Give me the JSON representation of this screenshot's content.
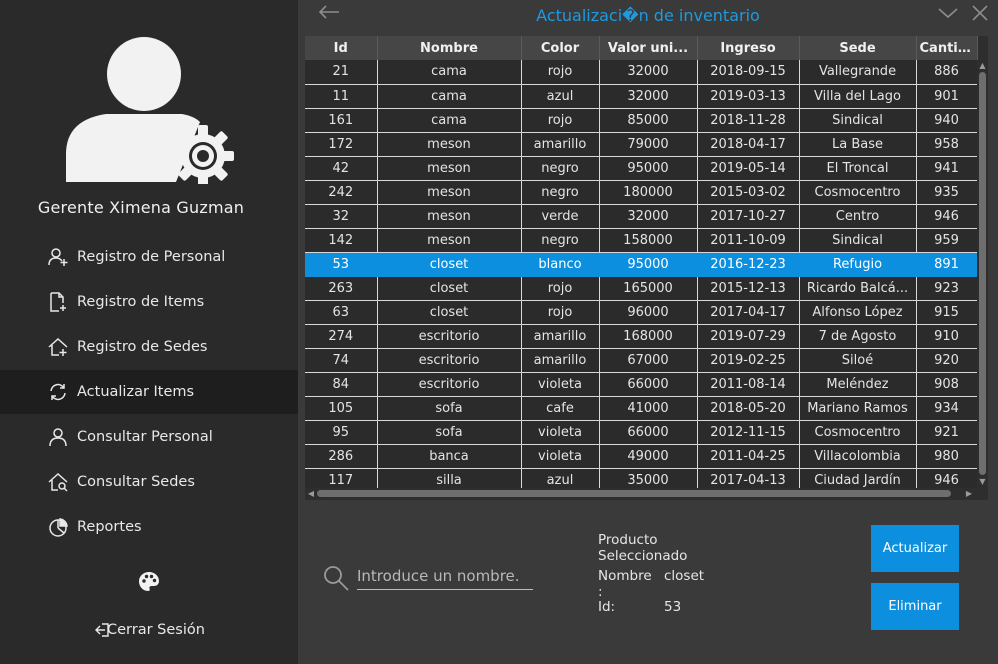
{
  "sidebar": {
    "user_name": "Gerente Ximena Guzman",
    "items": [
      {
        "label": "Registro de Personal",
        "icon": "add-user-icon"
      },
      {
        "label": "Registro de Items",
        "icon": "add-document-icon"
      },
      {
        "label": "Registro de Sedes",
        "icon": "add-home-icon"
      },
      {
        "label": "Actualizar Items",
        "icon": "refresh-icon",
        "active": true
      },
      {
        "label": "Consultar Personal",
        "icon": "user-icon"
      },
      {
        "label": "Consultar Sedes",
        "icon": "home-search-icon"
      },
      {
        "label": "Reportes",
        "icon": "pie-chart-icon"
      }
    ],
    "theme_icon": "palette-icon",
    "logout_label": "Cerrar Sesión"
  },
  "header": {
    "title": "Actualizaci�n de inventario"
  },
  "table": {
    "columns": [
      "Id",
      "Nombre",
      "Color",
      "Valor uni...",
      "Ingreso",
      "Sede",
      "Cantid..."
    ],
    "rows": [
      [
        "21",
        "cama",
        "rojo",
        "32000",
        "2018-09-15",
        "Vallegrande",
        "886"
      ],
      [
        "11",
        "cama",
        "azul",
        "32000",
        "2019-03-13",
        "Villa del Lago",
        "901"
      ],
      [
        "161",
        "cama",
        "rojo",
        "85000",
        "2018-11-28",
        "Sindical",
        "940"
      ],
      [
        "172",
        "meson",
        "amarillo",
        "79000",
        "2018-04-17",
        "La Base",
        "958"
      ],
      [
        "42",
        "meson",
        "negro",
        "95000",
        "2019-05-14",
        "El Troncal",
        "941"
      ],
      [
        "242",
        "meson",
        "negro",
        "180000",
        "2015-03-02",
        "Cosmocentro",
        "935"
      ],
      [
        "32",
        "meson",
        "verde",
        "32000",
        "2017-10-27",
        "Centro",
        "946"
      ],
      [
        "142",
        "meson",
        "negro",
        "158000",
        "2011-10-09",
        "Sindical",
        "959"
      ],
      [
        "53",
        "closet",
        "blanco",
        "95000",
        "2016-12-23",
        "Refugio",
        "891"
      ],
      [
        "263",
        "closet",
        "rojo",
        "165000",
        "2015-12-13",
        "Ricardo Balcá...",
        "923"
      ],
      [
        "63",
        "closet",
        "rojo",
        "96000",
        "2017-04-17",
        "Alfonso López",
        "915"
      ],
      [
        "274",
        "escritorio",
        "amarillo",
        "168000",
        "2019-07-29",
        "7 de Agosto",
        "910"
      ],
      [
        "74",
        "escritorio",
        "amarillo",
        "67000",
        "2019-02-25",
        "Siloé",
        "920"
      ],
      [
        "84",
        "escritorio",
        "violeta",
        "66000",
        "2011-08-14",
        "Meléndez",
        "908"
      ],
      [
        "105",
        "sofa",
        "cafe",
        "41000",
        "2018-05-20",
        "Mariano Ramos",
        "934"
      ],
      [
        "95",
        "sofa",
        "violeta",
        "66000",
        "2012-11-15",
        "Cosmocentro",
        "921"
      ],
      [
        "286",
        "banca",
        "violeta",
        "49000",
        "2011-04-25",
        "Villacolombia",
        "980"
      ],
      [
        "117",
        "silla",
        "azul",
        "35000",
        "2017-04-13",
        "Ciudad Jardín",
        "946"
      ]
    ],
    "selected_row": 8
  },
  "search": {
    "placeholder": "Introduce un nombre."
  },
  "selection": {
    "heading": "Producto Seleccionado",
    "name_label": "Nombre :",
    "name_value": "closet",
    "id_label": "Id:",
    "id_value": "53"
  },
  "actions": {
    "update_label": "Actualizar",
    "delete_label": "Eliminar"
  },
  "colors": {
    "accent": "#0d8fe0",
    "title": "#1e9ae0",
    "sidebar_bg": "#2a2a2a",
    "main_bg": "#3a3a3a"
  }
}
